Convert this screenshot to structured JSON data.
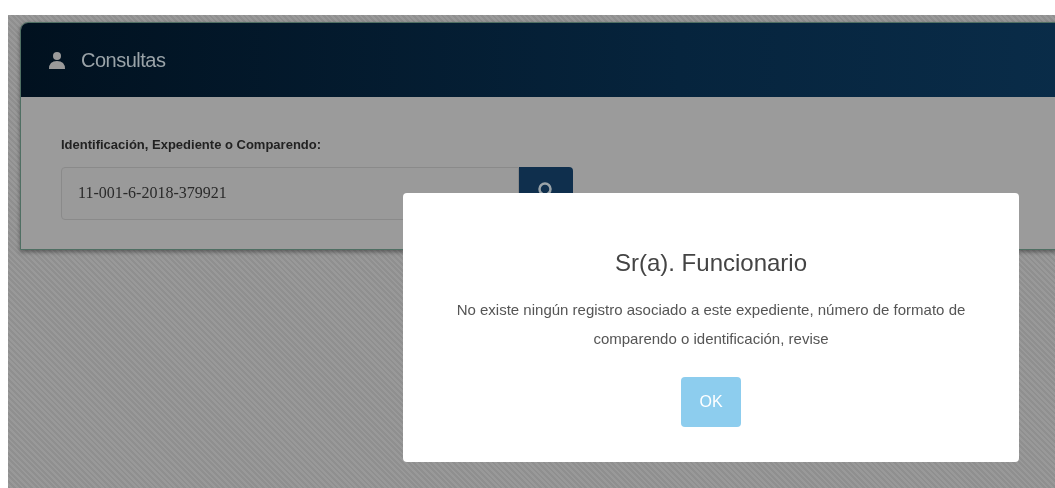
{
  "panel": {
    "title": "Consultas",
    "field_label": "Identificación, Expediente o Comparendo:",
    "field_value": "11-001-6-2018-379921"
  },
  "dialog": {
    "title": "Sr(a). Funcionario",
    "message": "No existe ningún registro asociado a este expediente, número de formato de comparendo o identificación, revise",
    "buttons": [
      {
        "label": "OK",
        "disabled": true
      }
    ]
  }
}
